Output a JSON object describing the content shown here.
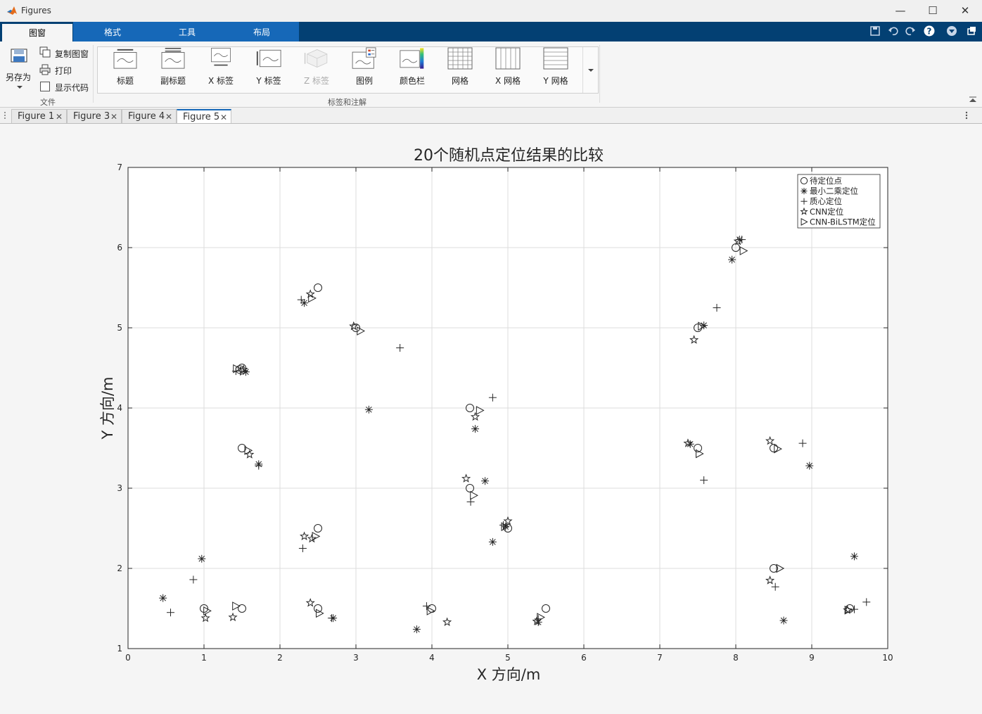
{
  "window": {
    "title": "Figures",
    "minimize": "—",
    "maximize": "☐",
    "close": "✕"
  },
  "ribbon_tabs": [
    "图窗",
    "格式",
    "工具",
    "布局"
  ],
  "file_group": {
    "save_as": "另存为",
    "copy_figure": "复制图窗",
    "print": "打印",
    "show_code": "显示代码",
    "label": "文件"
  },
  "annotation_group": {
    "label": "标签和注解",
    "buttons": [
      "标题",
      "副标题",
      "X 标签",
      "Y 标签",
      "Z 标签",
      "图例",
      "颜色栏",
      "网格",
      "X 网格",
      "Y 网格"
    ]
  },
  "doc_tabs": [
    "Figure 1",
    "Figure 3",
    "Figure 4",
    "Figure 5"
  ],
  "active_doc_tab": "Figure 5",
  "chart_data": {
    "type": "scatter",
    "title": "20个随机点定位结果的比较",
    "xlabel": "X 方向/m",
    "ylabel": "Y 方向/m",
    "xlim": [
      0,
      10
    ],
    "ylim": [
      1,
      7
    ],
    "xticks": [
      0,
      1,
      2,
      3,
      4,
      5,
      6,
      7,
      8,
      9,
      10
    ],
    "yticks": [
      1,
      2,
      3,
      4,
      5,
      6,
      7
    ],
    "grid": true,
    "legend_position": "top-right",
    "series": [
      {
        "name": "待定位点",
        "marker": "circle",
        "points": [
          [
            1.0,
            1.5
          ],
          [
            1.5,
            1.5
          ],
          [
            1.5,
            3.5
          ],
          [
            1.5,
            4.5
          ],
          [
            2.5,
            1.5
          ],
          [
            2.5,
            2.5
          ],
          [
            2.5,
            5.5
          ],
          [
            3.0,
            5.0
          ],
          [
            4.0,
            1.5
          ],
          [
            4.5,
            3.0
          ],
          [
            4.5,
            4.0
          ],
          [
            5.0,
            2.5
          ],
          [
            5.5,
            1.5
          ],
          [
            7.5,
            3.5
          ],
          [
            7.5,
            5.0
          ],
          [
            8.0,
            6.0
          ],
          [
            8.5,
            2.0
          ],
          [
            8.5,
            3.5
          ],
          [
            9.5,
            1.5
          ],
          [
            1.47,
            4.48
          ]
        ]
      },
      {
        "name": "最小二乘定位",
        "marker": "asterisk",
        "points": [
          [
            0.46,
            1.63
          ],
          [
            0.97,
            2.12
          ],
          [
            1.55,
            4.45
          ],
          [
            1.72,
            3.3
          ],
          [
            2.32,
            5.31
          ],
          [
            2.7,
            1.38
          ],
          [
            3.17,
            3.98
          ],
          [
            3.8,
            1.24
          ],
          [
            4.57,
            3.74
          ],
          [
            4.7,
            3.09
          ],
          [
            4.8,
            2.33
          ],
          [
            4.97,
            2.52
          ],
          [
            5.4,
            1.33
          ],
          [
            7.4,
            3.55
          ],
          [
            7.58,
            5.03
          ],
          [
            7.95,
            5.85
          ],
          [
            8.05,
            6.1
          ],
          [
            8.63,
            1.35
          ],
          [
            8.97,
            3.28
          ],
          [
            9.56,
            2.15
          ]
        ]
      },
      {
        "name": "质心定位",
        "marker": "plus",
        "points": [
          [
            0.56,
            1.45
          ],
          [
            0.86,
            1.86
          ],
          [
            1.42,
            4.46
          ],
          [
            1.72,
            3.28
          ],
          [
            2.28,
            5.35
          ],
          [
            2.3,
            2.25
          ],
          [
            2.68,
            1.38
          ],
          [
            3.58,
            4.75
          ],
          [
            3.93,
            1.53
          ],
          [
            4.51,
            2.83
          ],
          [
            4.8,
            4.13
          ],
          [
            4.94,
            2.54
          ],
          [
            5.4,
            1.37
          ],
          [
            7.58,
            3.1
          ],
          [
            7.75,
            5.25
          ],
          [
            8.08,
            6.1
          ],
          [
            8.52,
            1.77
          ],
          [
            8.88,
            3.56
          ],
          [
            9.56,
            1.49
          ],
          [
            9.72,
            1.58
          ]
        ]
      },
      {
        "name": "CNN定位",
        "marker": "pentagram",
        "points": [
          [
            1.02,
            1.38
          ],
          [
            1.38,
            1.39
          ],
          [
            1.52,
            4.48
          ],
          [
            1.6,
            3.42
          ],
          [
            2.32,
            2.4
          ],
          [
            2.4,
            1.57
          ],
          [
            2.4,
            5.42
          ],
          [
            2.97,
            5.02
          ],
          [
            4.2,
            1.33
          ],
          [
            4.45,
            3.12
          ],
          [
            4.57,
            3.89
          ],
          [
            5.0,
            2.59
          ],
          [
            5.38,
            1.34
          ],
          [
            7.45,
            4.85
          ],
          [
            7.37,
            3.56
          ],
          [
            8.45,
            3.59
          ],
          [
            8.45,
            1.85
          ],
          [
            8.03,
            6.08
          ],
          [
            9.47,
            1.48
          ],
          [
            2.42,
            2.37
          ]
        ]
      },
      {
        "name": "CNN-BiLSTM定位",
        "marker": "triangle-right",
        "points": [
          [
            1.04,
            1.47
          ],
          [
            1.42,
            1.53
          ],
          [
            1.58,
            3.47
          ],
          [
            1.52,
            4.46
          ],
          [
            2.47,
            2.4
          ],
          [
            2.52,
            1.44
          ],
          [
            2.42,
            5.37
          ],
          [
            3.06,
            4.96
          ],
          [
            3.98,
            1.47
          ],
          [
            4.55,
            2.91
          ],
          [
            4.63,
            3.97
          ],
          [
            4.96,
            2.52
          ],
          [
            5.43,
            1.39
          ],
          [
            7.52,
            3.43
          ],
          [
            7.55,
            5.02
          ],
          [
            8.1,
            5.96
          ],
          [
            8.58,
            2.0
          ],
          [
            8.55,
            3.49
          ],
          [
            9.48,
            1.48
          ],
          [
            1.43,
            4.49
          ]
        ]
      }
    ]
  }
}
